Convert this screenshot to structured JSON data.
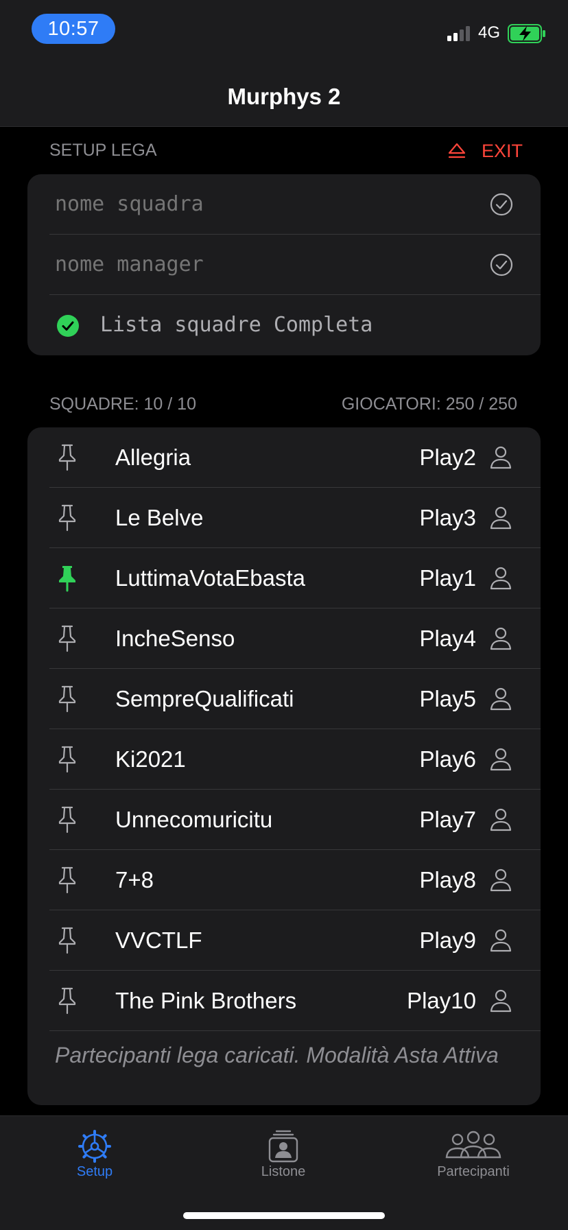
{
  "status_bar": {
    "time": "10:57",
    "network": "4G"
  },
  "nav": {
    "title": "Murphys 2"
  },
  "setup": {
    "header": "SETUP LEGA",
    "exit_label": "EXIT",
    "team_name_placeholder": "nome squadra",
    "manager_name_placeholder": "nome manager",
    "complete_text": "Lista squadre Completa"
  },
  "counts": {
    "teams": "SQUADRE: 10 / 10",
    "players": "GIOCATORI: 250 / 250"
  },
  "teams": [
    {
      "name": "Allegria",
      "player": "Play2",
      "pinned": false
    },
    {
      "name": "Le Belve",
      "player": "Play3",
      "pinned": false
    },
    {
      "name": "LuttimaVotaEbasta",
      "player": "Play1",
      "pinned": true
    },
    {
      "name": "IncheSenso",
      "player": "Play4",
      "pinned": false
    },
    {
      "name": "SempreQualificati",
      "player": "Play5",
      "pinned": false
    },
    {
      "name": "Ki2021",
      "player": "Play6",
      "pinned": false
    },
    {
      "name": "Unnecomuricitu",
      "player": "Play7",
      "pinned": false
    },
    {
      "name": "7+8",
      "player": "Play8",
      "pinned": false
    },
    {
      "name": "VVCTLF",
      "player": "Play9",
      "pinned": false
    },
    {
      "name": "The Pink Brothers",
      "player": "Play10",
      "pinned": false
    }
  ],
  "footer_note": "Partecipanti lega caricati. Modalità Asta Attiva",
  "tabs": [
    {
      "label": "Setup",
      "icon": "gear-icon",
      "active": true
    },
    {
      "label": "Listone",
      "icon": "list-icon",
      "active": false
    },
    {
      "label": "Partecipanti",
      "icon": "people-icon",
      "active": false
    }
  ],
  "colors": {
    "accent": "#2f7cf6",
    "danger": "#ff453a",
    "success": "#30d158",
    "background": "#000000",
    "card": "#1c1c1e"
  }
}
